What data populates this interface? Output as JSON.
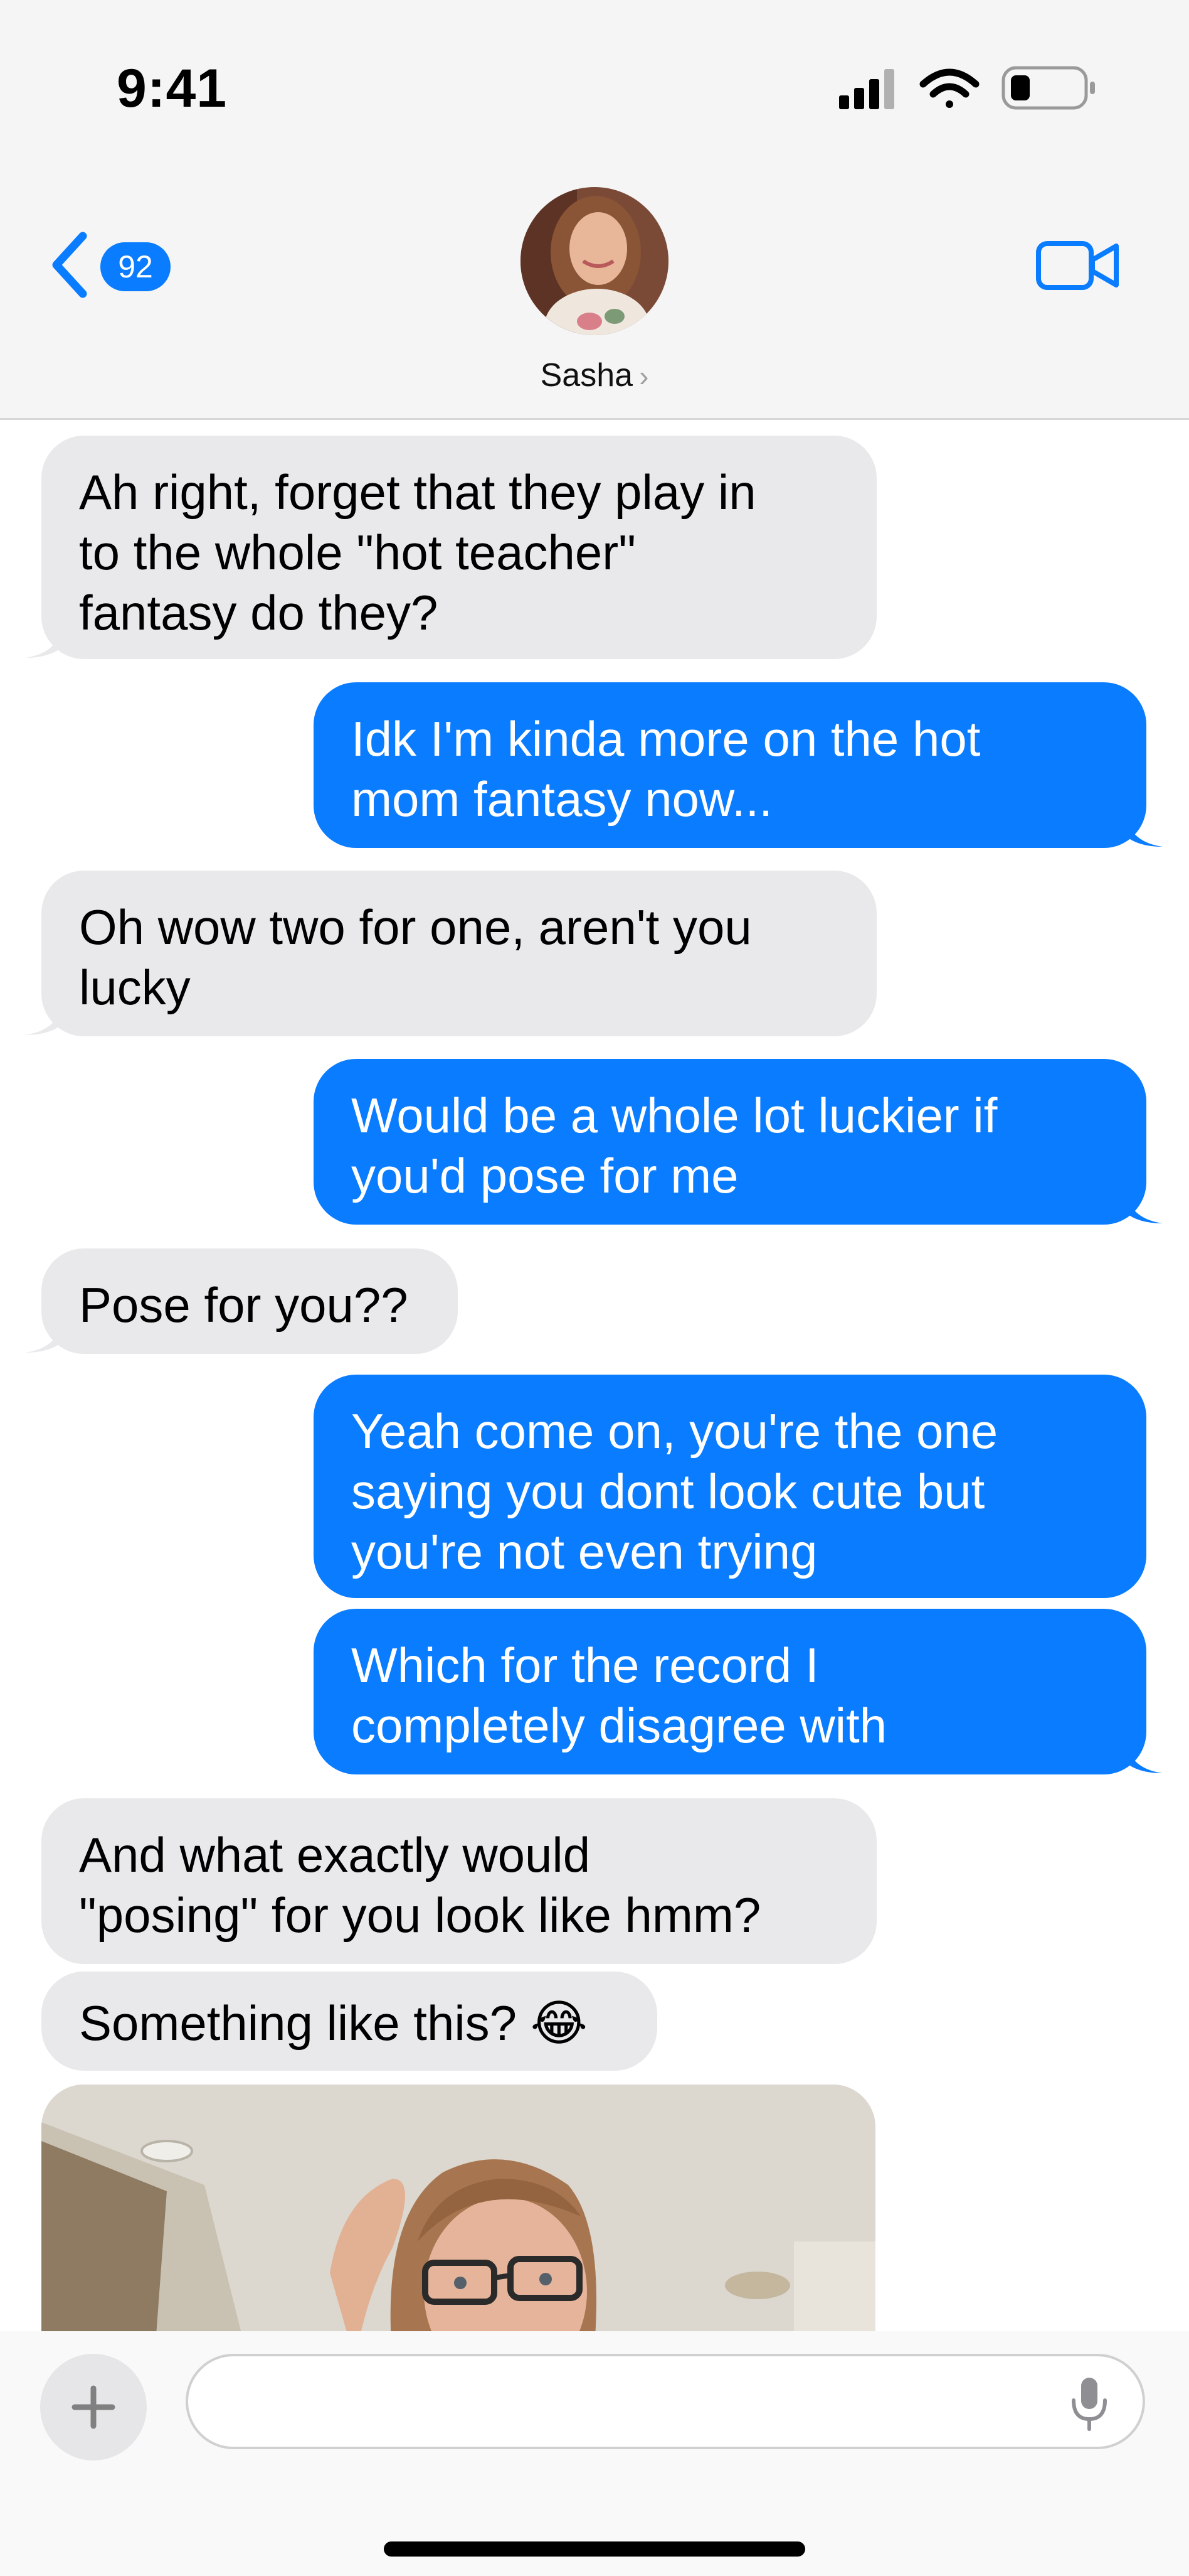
{
  "status_bar": {
    "time": "9:41"
  },
  "header": {
    "back_badge": "92",
    "contact_name": "Sasha"
  },
  "messages": [
    {
      "direction": "incoming",
      "lines": [
        "Ah right, forget that they play in",
        "to the whole \"hot teacher\"",
        "fantasy do they?"
      ]
    },
    {
      "direction": "outgoing",
      "lines": [
        "Idk I'm kinda more on the hot",
        "mom fantasy now..."
      ]
    },
    {
      "direction": "incoming",
      "lines": [
        "Oh wow two for one, aren't you",
        "lucky"
      ]
    },
    {
      "direction": "outgoing",
      "lines": [
        "Would be a whole lot luckier if",
        "you'd pose for me"
      ]
    },
    {
      "direction": "incoming",
      "lines": [
        "Pose for you??"
      ]
    },
    {
      "direction": "outgoing",
      "lines": [
        "Yeah come on, you're the one",
        "saying you dont look cute but",
        "you're not even trying"
      ]
    },
    {
      "direction": "outgoing",
      "lines": [
        "Which for the record I",
        "completely disagree with"
      ]
    },
    {
      "direction": "incoming",
      "lines": [
        "And what exactly would",
        "\"posing\" for you look like hmm?"
      ]
    },
    {
      "direction": "incoming",
      "lines": [
        "Something like this? 😂"
      ]
    }
  ],
  "composer": {
    "placeholder": ""
  },
  "colors": {
    "accent": "#0a7cff",
    "incoming_bubble": "#e9e9eb"
  },
  "icons": [
    "cellular-signal-icon",
    "wifi-icon",
    "battery-icon",
    "back-chevron-icon",
    "video-camera-icon",
    "plus-icon",
    "microphone-icon"
  ]
}
